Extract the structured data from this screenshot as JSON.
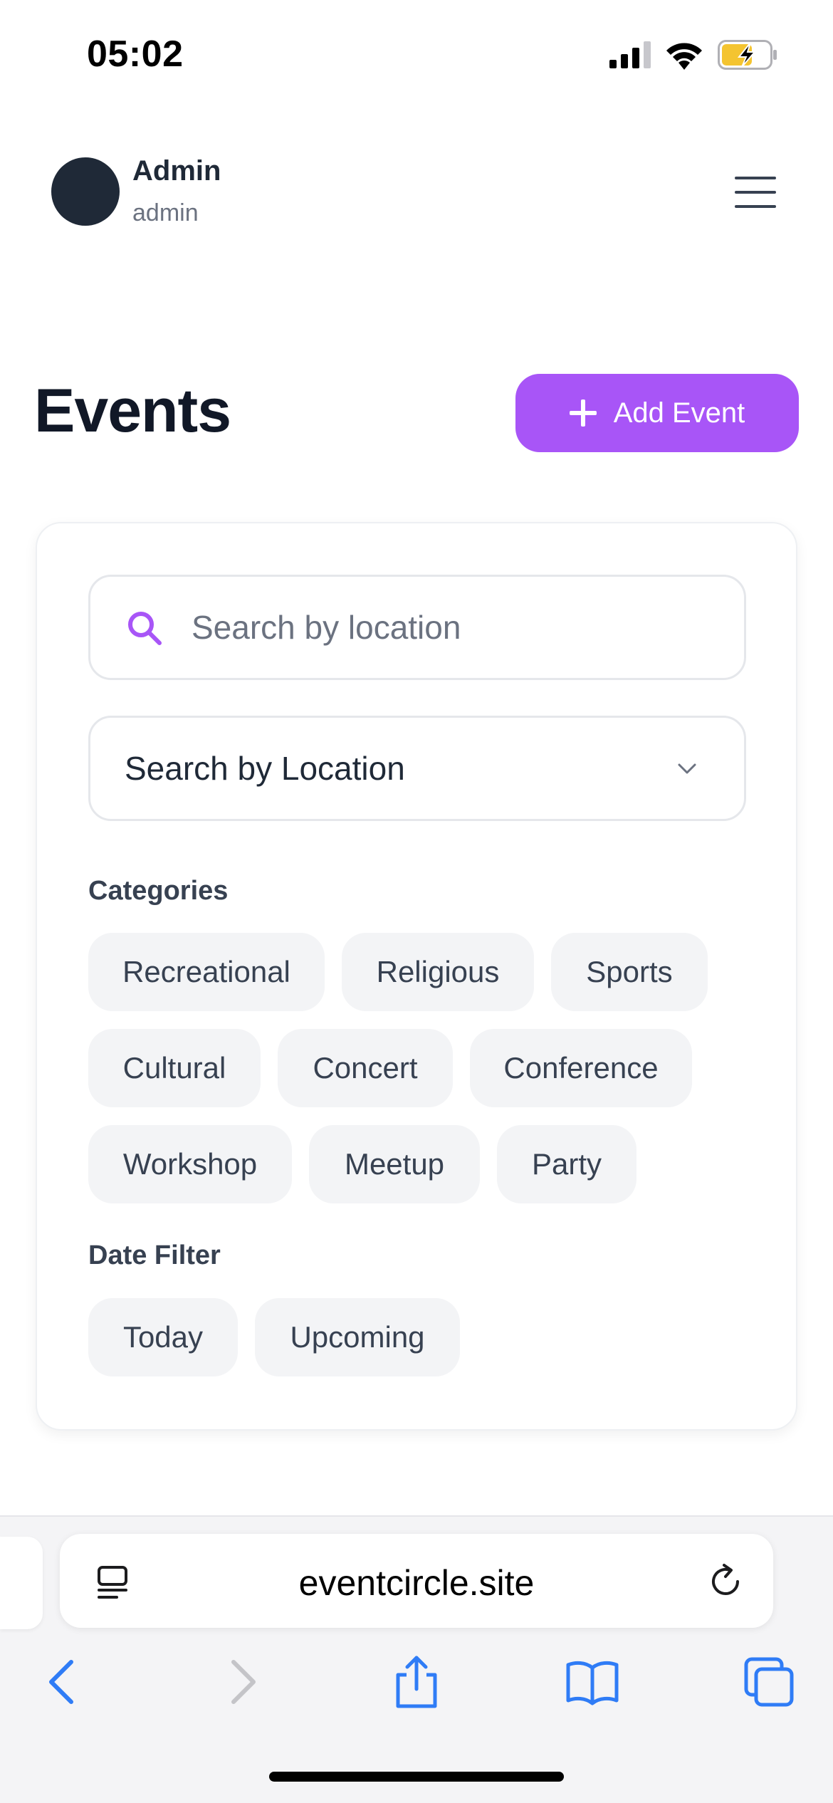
{
  "status_bar": {
    "time": "05:02"
  },
  "user": {
    "name": "Admin",
    "role": "admin"
  },
  "page": {
    "title": "Events",
    "add_button_label": "Add Event"
  },
  "filters": {
    "search_placeholder": "Search by location",
    "location_select_value": "Search by Location",
    "categories_label": "Categories",
    "categories": [
      "Recreational",
      "Religious",
      "Sports",
      "Cultural",
      "Concert",
      "Conference",
      "Workshop",
      "Meetup",
      "Party"
    ],
    "date_filter_label": "Date Filter",
    "date_filters": [
      "Today",
      "Upcoming"
    ]
  },
  "browser": {
    "url": "eventcircle.site"
  },
  "colors": {
    "accent": "#a855f7",
    "text_dark": "#111827",
    "chip_bg": "#f3f4f6",
    "safari_blue": "#2f7cf6"
  },
  "icons": [
    "search-icon",
    "chevron-down-icon",
    "plus-icon",
    "menu-icon",
    "page-menu-icon",
    "reload-icon",
    "back-icon",
    "forward-icon",
    "share-icon",
    "bookmarks-icon",
    "tabs-icon"
  ]
}
